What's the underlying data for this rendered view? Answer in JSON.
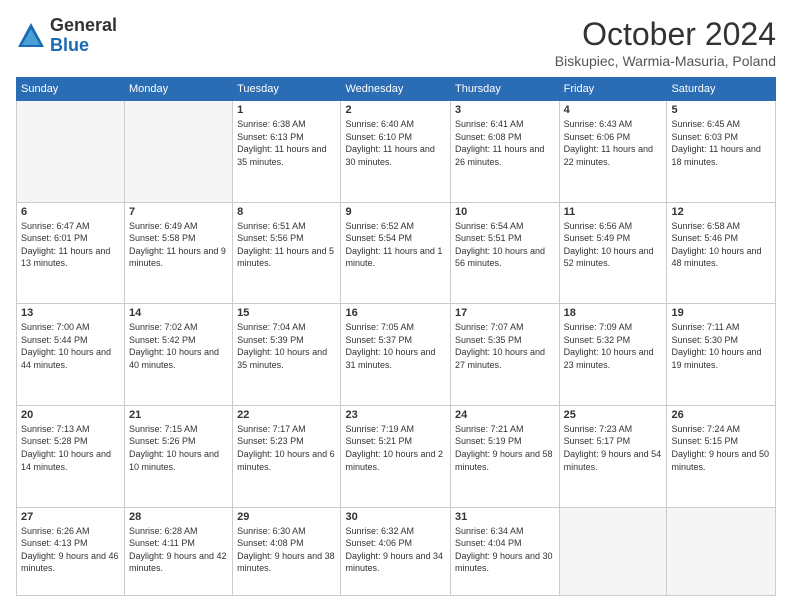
{
  "header": {
    "logo_general": "General",
    "logo_blue": "Blue",
    "month_title": "October 2024",
    "location": "Biskupiec, Warmia-Masuria, Poland"
  },
  "days_of_week": [
    "Sunday",
    "Monday",
    "Tuesday",
    "Wednesday",
    "Thursday",
    "Friday",
    "Saturday"
  ],
  "weeks": [
    [
      {
        "day": "",
        "empty": true
      },
      {
        "day": "",
        "empty": true
      },
      {
        "day": "1",
        "sunrise": "6:38 AM",
        "sunset": "6:13 PM",
        "daylight": "11 hours and 35 minutes."
      },
      {
        "day": "2",
        "sunrise": "6:40 AM",
        "sunset": "6:10 PM",
        "daylight": "11 hours and 30 minutes."
      },
      {
        "day": "3",
        "sunrise": "6:41 AM",
        "sunset": "6:08 PM",
        "daylight": "11 hours and 26 minutes."
      },
      {
        "day": "4",
        "sunrise": "6:43 AM",
        "sunset": "6:06 PM",
        "daylight": "11 hours and 22 minutes."
      },
      {
        "day": "5",
        "sunrise": "6:45 AM",
        "sunset": "6:03 PM",
        "daylight": "11 hours and 18 minutes."
      }
    ],
    [
      {
        "day": "6",
        "sunrise": "6:47 AM",
        "sunset": "6:01 PM",
        "daylight": "11 hours and 13 minutes."
      },
      {
        "day": "7",
        "sunrise": "6:49 AM",
        "sunset": "5:58 PM",
        "daylight": "11 hours and 9 minutes."
      },
      {
        "day": "8",
        "sunrise": "6:51 AM",
        "sunset": "5:56 PM",
        "daylight": "11 hours and 5 minutes."
      },
      {
        "day": "9",
        "sunrise": "6:52 AM",
        "sunset": "5:54 PM",
        "daylight": "11 hours and 1 minute."
      },
      {
        "day": "10",
        "sunrise": "6:54 AM",
        "sunset": "5:51 PM",
        "daylight": "10 hours and 56 minutes."
      },
      {
        "day": "11",
        "sunrise": "6:56 AM",
        "sunset": "5:49 PM",
        "daylight": "10 hours and 52 minutes."
      },
      {
        "day": "12",
        "sunrise": "6:58 AM",
        "sunset": "5:46 PM",
        "daylight": "10 hours and 48 minutes."
      }
    ],
    [
      {
        "day": "13",
        "sunrise": "7:00 AM",
        "sunset": "5:44 PM",
        "daylight": "10 hours and 44 minutes."
      },
      {
        "day": "14",
        "sunrise": "7:02 AM",
        "sunset": "5:42 PM",
        "daylight": "10 hours and 40 minutes."
      },
      {
        "day": "15",
        "sunrise": "7:04 AM",
        "sunset": "5:39 PM",
        "daylight": "10 hours and 35 minutes."
      },
      {
        "day": "16",
        "sunrise": "7:05 AM",
        "sunset": "5:37 PM",
        "daylight": "10 hours and 31 minutes."
      },
      {
        "day": "17",
        "sunrise": "7:07 AM",
        "sunset": "5:35 PM",
        "daylight": "10 hours and 27 minutes."
      },
      {
        "day": "18",
        "sunrise": "7:09 AM",
        "sunset": "5:32 PM",
        "daylight": "10 hours and 23 minutes."
      },
      {
        "day": "19",
        "sunrise": "7:11 AM",
        "sunset": "5:30 PM",
        "daylight": "10 hours and 19 minutes."
      }
    ],
    [
      {
        "day": "20",
        "sunrise": "7:13 AM",
        "sunset": "5:28 PM",
        "daylight": "10 hours and 14 minutes."
      },
      {
        "day": "21",
        "sunrise": "7:15 AM",
        "sunset": "5:26 PM",
        "daylight": "10 hours and 10 minutes."
      },
      {
        "day": "22",
        "sunrise": "7:17 AM",
        "sunset": "5:23 PM",
        "daylight": "10 hours and 6 minutes."
      },
      {
        "day": "23",
        "sunrise": "7:19 AM",
        "sunset": "5:21 PM",
        "daylight": "10 hours and 2 minutes."
      },
      {
        "day": "24",
        "sunrise": "7:21 AM",
        "sunset": "5:19 PM",
        "daylight": "9 hours and 58 minutes."
      },
      {
        "day": "25",
        "sunrise": "7:23 AM",
        "sunset": "5:17 PM",
        "daylight": "9 hours and 54 minutes."
      },
      {
        "day": "26",
        "sunrise": "7:24 AM",
        "sunset": "5:15 PM",
        "daylight": "9 hours and 50 minutes."
      }
    ],
    [
      {
        "day": "27",
        "sunrise": "6:26 AM",
        "sunset": "4:13 PM",
        "daylight": "9 hours and 46 minutes."
      },
      {
        "day": "28",
        "sunrise": "6:28 AM",
        "sunset": "4:11 PM",
        "daylight": "9 hours and 42 minutes."
      },
      {
        "day": "29",
        "sunrise": "6:30 AM",
        "sunset": "4:08 PM",
        "daylight": "9 hours and 38 minutes."
      },
      {
        "day": "30",
        "sunrise": "6:32 AM",
        "sunset": "4:06 PM",
        "daylight": "9 hours and 34 minutes."
      },
      {
        "day": "31",
        "sunrise": "6:34 AM",
        "sunset": "4:04 PM",
        "daylight": "9 hours and 30 minutes."
      },
      {
        "day": "",
        "empty": true
      },
      {
        "day": "",
        "empty": true
      }
    ]
  ]
}
